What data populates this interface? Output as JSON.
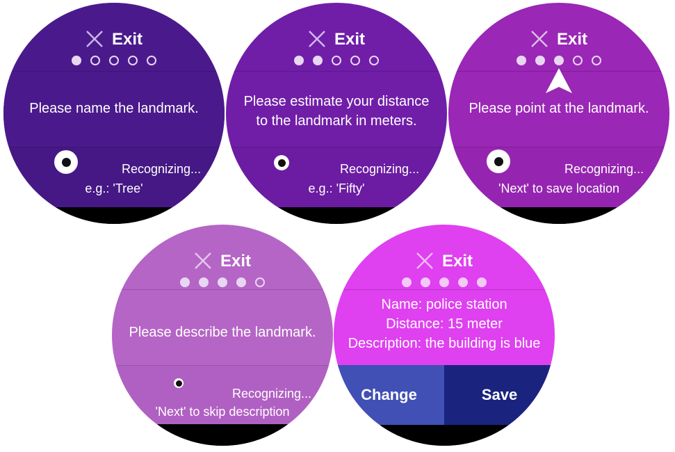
{
  "common": {
    "exit_label": "Exit",
    "recognizing": "Recognizing..."
  },
  "colors": {
    "screen1": "#4a1a8c",
    "screen2": "#701ea8",
    "screen3": "#9a27b5",
    "screen4": "#b565c6",
    "screen5": "#df40f0",
    "change_button": "#4150b5",
    "save_button": "#1a237e"
  },
  "screens": [
    {
      "step": 1,
      "progress": [
        1,
        0,
        0,
        0,
        0
      ],
      "prompt": "Please name the landmark.",
      "hint": "e.g.: 'Tree'"
    },
    {
      "step": 2,
      "progress": [
        1,
        1,
        0,
        0,
        0
      ],
      "prompt": "Please estimate your distance to the landmark in meters.",
      "hint": "e.g.: 'Fifty'"
    },
    {
      "step": 3,
      "progress": [
        1,
        1,
        1,
        0,
        0
      ],
      "prompt": "Please point at the landmark.",
      "hint": "'Next' to save location",
      "icons": [
        "navigation-arrow-icon"
      ]
    },
    {
      "step": 4,
      "progress": [
        1,
        1,
        1,
        1,
        0
      ],
      "prompt": "Please describe the landmark.",
      "hint": "'Next' to skip description"
    },
    {
      "step": 5,
      "progress": [
        1,
        1,
        1,
        1,
        1
      ],
      "summary": {
        "name": "Name: police station",
        "distance": "Distance: 15 meter",
        "description": "Description: the building is blue"
      },
      "change_label": "Change",
      "save_label": "Save"
    }
  ]
}
